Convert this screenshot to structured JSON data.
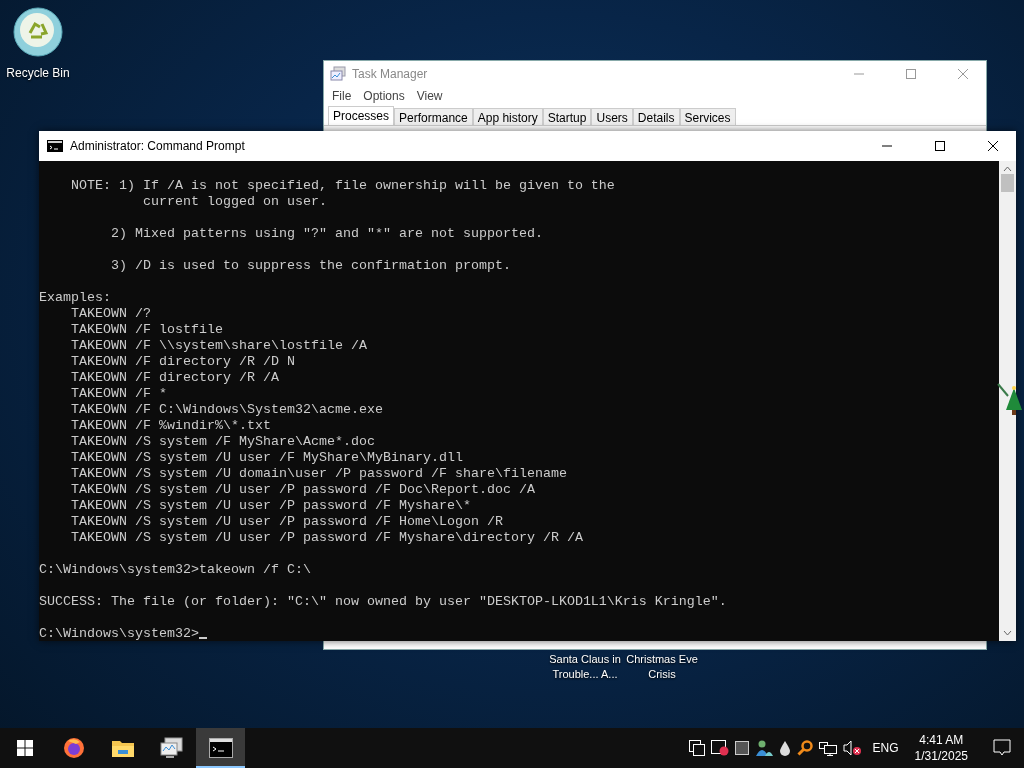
{
  "desktop_icons": [
    {
      "label": "Recycle Bin"
    }
  ],
  "desktop_shortcuts": [
    {
      "lines": [
        "Santa Claus in",
        "Trouble... A..."
      ]
    },
    {
      "lines": [
        "Christmas Eve",
        "Crisis"
      ]
    }
  ],
  "task_manager": {
    "title": "Task Manager",
    "menu": [
      "File",
      "Options",
      "View"
    ],
    "tabs": [
      {
        "label": "Processes",
        "selected": true
      },
      {
        "label": "Performance",
        "selected": false
      },
      {
        "label": "App history",
        "selected": false
      },
      {
        "label": "Startup",
        "selected": false
      },
      {
        "label": "Users",
        "selected": false
      },
      {
        "label": "Details",
        "selected": false
      },
      {
        "label": "Services",
        "selected": false
      }
    ]
  },
  "command_prompt": {
    "title": "Administrator: Command Prompt",
    "blocks": [
      [
        "    NOTE: 1) If /A is not specified, file ownership will be given to the",
        "             current logged on user."
      ],
      [
        "         2) Mixed patterns using \"?\" and \"*\" are not supported."
      ],
      [
        "         3) /D is used to suppress the confirmation prompt."
      ],
      [
        "Examples:",
        "    TAKEOWN /?",
        "    TAKEOWN /F lostfile",
        "    TAKEOWN /F \\\\system\\share\\lostfile /A",
        "    TAKEOWN /F directory /R /D N",
        "    TAKEOWN /F directory /R /A",
        "    TAKEOWN /F *",
        "    TAKEOWN /F C:\\Windows\\System32\\acme.exe",
        "    TAKEOWN /F %windir%\\*.txt",
        "    TAKEOWN /S system /F MyShare\\Acme*.doc",
        "    TAKEOWN /S system /U user /F MyShare\\MyBinary.dll",
        "    TAKEOWN /S system /U domain\\user /P password /F share\\filename",
        "    TAKEOWN /S system /U user /P password /F Doc\\Report.doc /A",
        "    TAKEOWN /S system /U user /P password /F Myshare\\*",
        "    TAKEOWN /S system /U user /P password /F Home\\Logon /R",
        "    TAKEOWN /S system /U user /P password /F Myshare\\directory /R /A"
      ],
      [
        "C:\\Windows\\system32>takeown /f C:\\"
      ],
      [
        "SUCCESS: The file (or folder): \"C:\\\" now owned by user \"DESKTOP-LKOD1L1\\Kris Kringle\"."
      ],
      [
        "C:\\Windows\\system32>"
      ]
    ]
  },
  "taskbar": {
    "apps": [
      {
        "kind": "firefox",
        "active": false
      },
      {
        "kind": "explorer",
        "active": false
      },
      {
        "kind": "taskmgr",
        "active": false
      },
      {
        "kind": "cmd",
        "active": true
      }
    ],
    "language": "ENG",
    "time": "4:41 AM",
    "date": "1/31/2025"
  }
}
